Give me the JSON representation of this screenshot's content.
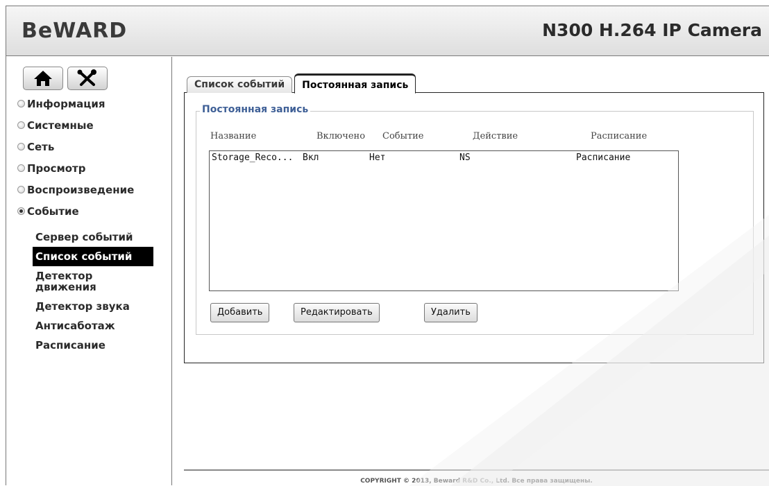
{
  "header": {
    "logo": "BeWARD",
    "product_title": "N300 H.264 IP Camera"
  },
  "sidebar": {
    "icons": [
      {
        "name": "home-icon"
      },
      {
        "name": "tools-icon"
      }
    ],
    "menu": [
      {
        "label": "Информация",
        "selected": false
      },
      {
        "label": "Системные",
        "selected": false
      },
      {
        "label": "Сеть",
        "selected": false
      },
      {
        "label": "Просмотр",
        "selected": false
      },
      {
        "label": "Воспроизведение",
        "selected": false
      },
      {
        "label": "Событие",
        "selected": true
      }
    ],
    "submenu": [
      {
        "label": "Сервер событий",
        "active": false
      },
      {
        "label": "Список событий",
        "active": true
      },
      {
        "label": "Детектор движения",
        "active": false
      },
      {
        "label": "Детектор звука",
        "active": false
      },
      {
        "label": "Антисаботаж",
        "active": false
      },
      {
        "label": "Расписание",
        "active": false
      }
    ]
  },
  "main": {
    "tabs": [
      {
        "label": "Список событий",
        "active": false
      },
      {
        "label": "Постоянная запись",
        "active": true
      }
    ],
    "section_title": "Постоянная запись",
    "columns": [
      "Название",
      "Включено",
      "Событие",
      "Действие",
      "Расписание"
    ],
    "rows": [
      [
        "Storage_Reco...",
        "Вкл",
        "Нет",
        "NS",
        "Расписание"
      ]
    ],
    "buttons": {
      "add": "Добавить",
      "edit": "Редактировать",
      "delete": "Удалить"
    }
  },
  "footer": {
    "copyright": "COPYRIGHT © 2013, Beward R&D Co., Ltd. Все права защищены."
  },
  "colors": {
    "legend_blue": "#3e5f96",
    "active_item_bg": "#000000",
    "header_gradient_top": "#f6f6f6",
    "header_gradient_bottom": "#dedede"
  }
}
